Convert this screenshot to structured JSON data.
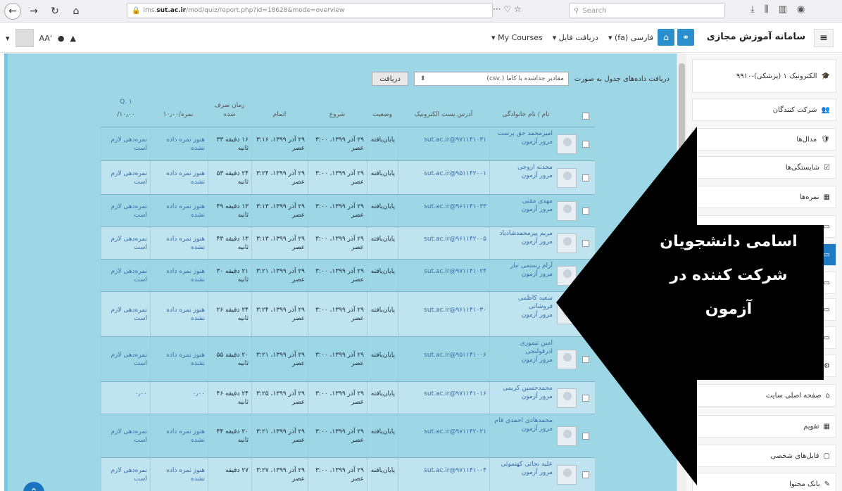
{
  "browser": {
    "url_prefix": "lms.",
    "url_domain": "sut.ac.ir",
    "url_rest": "/mod/quiz/report.php?id=18628&mode=overview",
    "search_placeholder": "Search",
    "page_actions": "··· ♡ ☆"
  },
  "navbar": {
    "font_size_label": "AA'",
    "menus": [
      "فارسی (fa)",
      "دریافت فایل",
      "My Courses"
    ],
    "site_title": "سامانه آموزش مجازی"
  },
  "export": {
    "label": "دریافت داده‌های جدول به صورت",
    "format": "مقادیر جداشده با کاما (.csv)",
    "button": "دریافت"
  },
  "table": {
    "headers": {
      "name": "نام / نام خانوادگی",
      "email": "آدرس پست الکترونیک",
      "status": "وضعیت",
      "started": "شروع",
      "completed": "اتمام",
      "duration": "زمان صرف شده",
      "grade": "نمره/۱۰٫۰۰",
      "q1": "Q. ۱",
      "q1_max": "۱۰٫۰۰/"
    },
    "rows": [
      {
        "name": "امیرمحمد حق پرست",
        "review": "مرور آزمون",
        "email": "sut.ac.ir@۹۷۱۱۴۱۰۳۱",
        "status": "پایان‌یافته",
        "started": "۲۹ آذر ۱۳۹۹، ۳:۰۰ عصر",
        "completed": "۲۹ آذر ۱۳۹۹، ۳:۱۶ عصر",
        "duration": "۱۶ دقیقه ۳۳ ثانیه",
        "grade": "هنوز نمره داده نشده",
        "q1": "نمره‌دهی لازم است"
      },
      {
        "name": "محدثه اروجی",
        "review": "مرور آزمون",
        "email": "sut.ac.ir@۹۵۱۱۴۲۰۰۱",
        "status": "پایان‌یافته",
        "started": "۲۹ آذر ۱۳۹۹، ۳:۰۰ عصر",
        "completed": "۲۹ آذر ۱۳۹۹، ۳:۲۴ عصر",
        "duration": "۲۴ دقیقه ۵۳ ثانیه",
        "grade": "هنوز نمره داده نشده",
        "q1": "نمره‌دهی لازم است"
      },
      {
        "name": "مهدی مقنی",
        "review": "مرور آزمون",
        "email": "sut.ac.ir@۹۶۱۱۴۱۰۳۳",
        "status": "پایان‌یافته",
        "started": "۲۹ آذر ۱۳۹۹، ۳:۰۰ عصر",
        "completed": "۲۹ آذر ۱۳۹۹، ۳:۱۳ عصر",
        "duration": "۱۳ دقیقه ۴۹ ثانیه",
        "grade": "هنوز نمره داده نشده",
        "q1": "نمره‌دهی لازم است"
      },
      {
        "name": "مریم پیرمحمدشادباد",
        "review": "مرور آزمون",
        "email": "sut.ac.ir@۹۶۱۱۴۲۰۰۵",
        "status": "پایان‌یافته",
        "started": "۲۹ آذر ۱۳۹۹، ۳:۰۰ عصر",
        "completed": "۲۹ آذر ۱۳۹۹، ۳:۱۳ عصر",
        "duration": "۱۳ دقیقه ۴۳ ثانیه",
        "grade": "هنوز نمره داده نشده",
        "q1": "نمره‌دهی لازم است"
      },
      {
        "name": "آرام رستمی تبار",
        "review": "مرور آزمون",
        "email": "sut.ac.ir@۹۷۱۱۴۱۰۲۴",
        "status": "پایان‌یافته",
        "started": "۲۹ آذر ۱۳۹۹، ۳:۰۰ عصر",
        "completed": "۲۹ آذر ۱۳۹۹، ۳:۲۱ عصر",
        "duration": "۲۱ دقیقه ۳۰ ثانیه",
        "grade": "هنوز نمره داده نشده",
        "q1": "نمره‌دهی لازم است"
      },
      {
        "name": "سعید کاظمی فروشانی",
        "review": "مرور آزمون",
        "email": "sut.ac.ir@۹۶۱۱۴۱۰۳۰",
        "status": "پایان‌یافته",
        "started": "۲۹ آذر ۱۳۹۹، ۳:۰۰ عصر",
        "completed": "۲۹ آذر ۱۳۹۹، ۳:۲۴ عصر",
        "duration": "۲۴ دقیقه ۲۶ ثانیه",
        "grade": "هنوز نمره داده نشده",
        "q1": "نمره‌دهی لازم است"
      },
      {
        "name": "امین تیموری اذرقولنجی",
        "review": "مرور آزمون",
        "email": "sut.ac.ir@۹۵۱۱۴۱۰۰۶",
        "status": "پایان‌یافته",
        "started": "۲۹ آذر ۱۳۹۹، ۳:۰۰ عصر",
        "completed": "۲۹ آذر ۱۳۹۹، ۳:۲۱ عصر",
        "duration": "۲۰ دقیقه ۵۵ ثانیه",
        "grade": "هنوز نمره داده نشده",
        "q1": "نمره‌دهی لازم است"
      },
      {
        "name": "محمدحسین کریمی",
        "review": "مرور آزمون",
        "email": "sut.ac.ir@۹۷۱۱۴۱۰۱۶",
        "status": "پایان‌یافته",
        "started": "۲۹ آذر ۱۳۹۹، ۳:۰۰ عصر",
        "completed": "۲۹ آذر ۱۳۹۹، ۳:۲۵ عصر",
        "duration": "۲۴ دقیقه ۴۶ ثانیه",
        "grade": "۰٫۰۰",
        "q1": "۰٫۰۰"
      },
      {
        "name": "محمدهادی احمدی فام",
        "review": "مرور آزمون",
        "email": "sut.ac.ir@۹۷۱۱۴۲۰۲۱",
        "status": "پایان‌یافته",
        "started": "۲۹ آذر ۱۳۹۹، ۳:۰۰ عصر",
        "completed": "۲۹ آذر ۱۳۹۹، ۳:۲۱ عصر",
        "duration": "۲۰ دقیقه ۴۴ ثانیه",
        "grade": "هنوز نمره داده نشده",
        "q1": "نمره‌دهی لازم است"
      },
      {
        "name": "علیه نجاتی کهنموئی",
        "review": "مرور آزمون",
        "email": "sut.ac.ir@۹۷۱۱۴۱۰۰۴",
        "status": "پایان‌یافته",
        "started": "۲۹ آذر ۱۳۹۹، ۳:۰۰ عصر",
        "completed": "۲۹ آذر ۱۳۹۹، ۳:۲۷ عصر",
        "duration": "۲۷ دقیقه",
        "grade": "هنوز نمره داده نشده",
        "q1": "نمره‌دهی لازم است"
      }
    ]
  },
  "sidebar": {
    "items": [
      {
        "label": "الکترونیک ۱ (پزشکی)-۹۹۱۰"
      },
      {
        "label": "شرکت کنندگان"
      },
      {
        "label": "مدال‌ها"
      },
      {
        "label": "شایستگی‌ها"
      },
      {
        "label": "نمره‌ها"
      },
      {
        "label": ""
      },
      {
        "label": ""
      },
      {
        "label": ""
      },
      {
        "label": ""
      },
      {
        "label": ""
      },
      {
        "label": ""
      },
      {
        "label": "صفحه اصلی سایت"
      },
      {
        "label": "تقویم"
      },
      {
        "label": "فایل‌های شخصی"
      },
      {
        "label": "بانک محتوا"
      }
    ]
  },
  "annotation": {
    "line1": "اسامی دانشجویان",
    "line2": "شرکت کننده در",
    "line3": "آزمون"
  },
  "colors": {
    "accent": "#2a8fcc",
    "table_bg": "#9dd7e6",
    "link": "#3b6ea8",
    "arrow": "#000000"
  }
}
